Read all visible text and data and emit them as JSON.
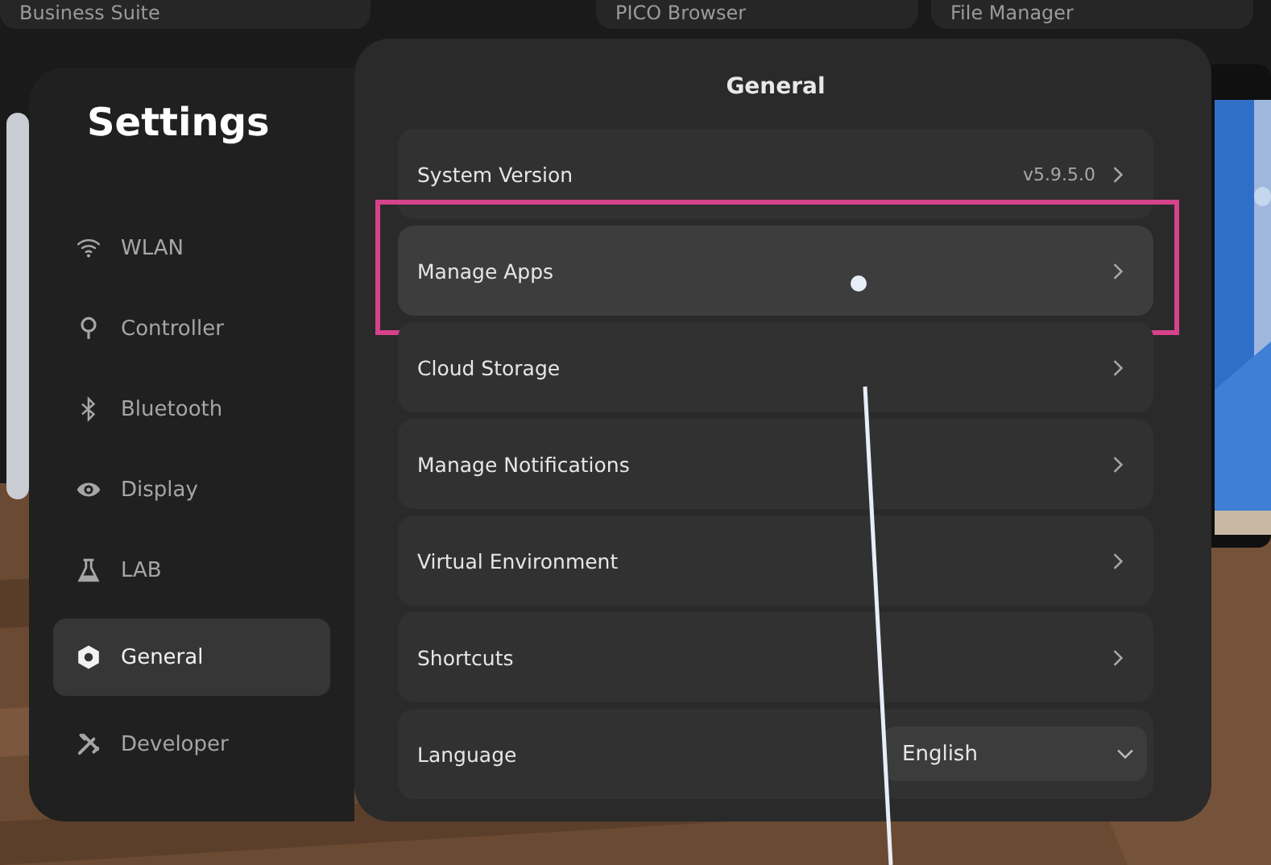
{
  "background_windows": [
    {
      "title": "Business Suite"
    },
    {
      "title": "PICO Browser"
    },
    {
      "title": "File Manager"
    }
  ],
  "sidebar": {
    "title": "Settings",
    "items": [
      {
        "label": "WLAN",
        "selected": false
      },
      {
        "label": "Controller",
        "selected": false
      },
      {
        "label": "Bluetooth",
        "selected": false
      },
      {
        "label": "Display",
        "selected": false
      },
      {
        "label": "LAB",
        "selected": false
      },
      {
        "label": "General",
        "selected": true
      },
      {
        "label": "Developer",
        "selected": false
      }
    ]
  },
  "content": {
    "title": "General",
    "rows": [
      {
        "kind": "link",
        "label": "System Version",
        "value": "v5.9.5.0",
        "highlighted": false
      },
      {
        "kind": "link",
        "label": "Manage Apps",
        "highlighted": true
      },
      {
        "kind": "link",
        "label": "Cloud Storage",
        "highlighted": false
      },
      {
        "kind": "link",
        "label": "Manage Notifications",
        "highlighted": false
      },
      {
        "kind": "link",
        "label": "Virtual Environment",
        "highlighted": false
      },
      {
        "kind": "link",
        "label": "Shortcuts",
        "highlighted": false
      },
      {
        "kind": "dropdown",
        "label": "Language",
        "value": "English",
        "highlighted": false
      }
    ]
  }
}
